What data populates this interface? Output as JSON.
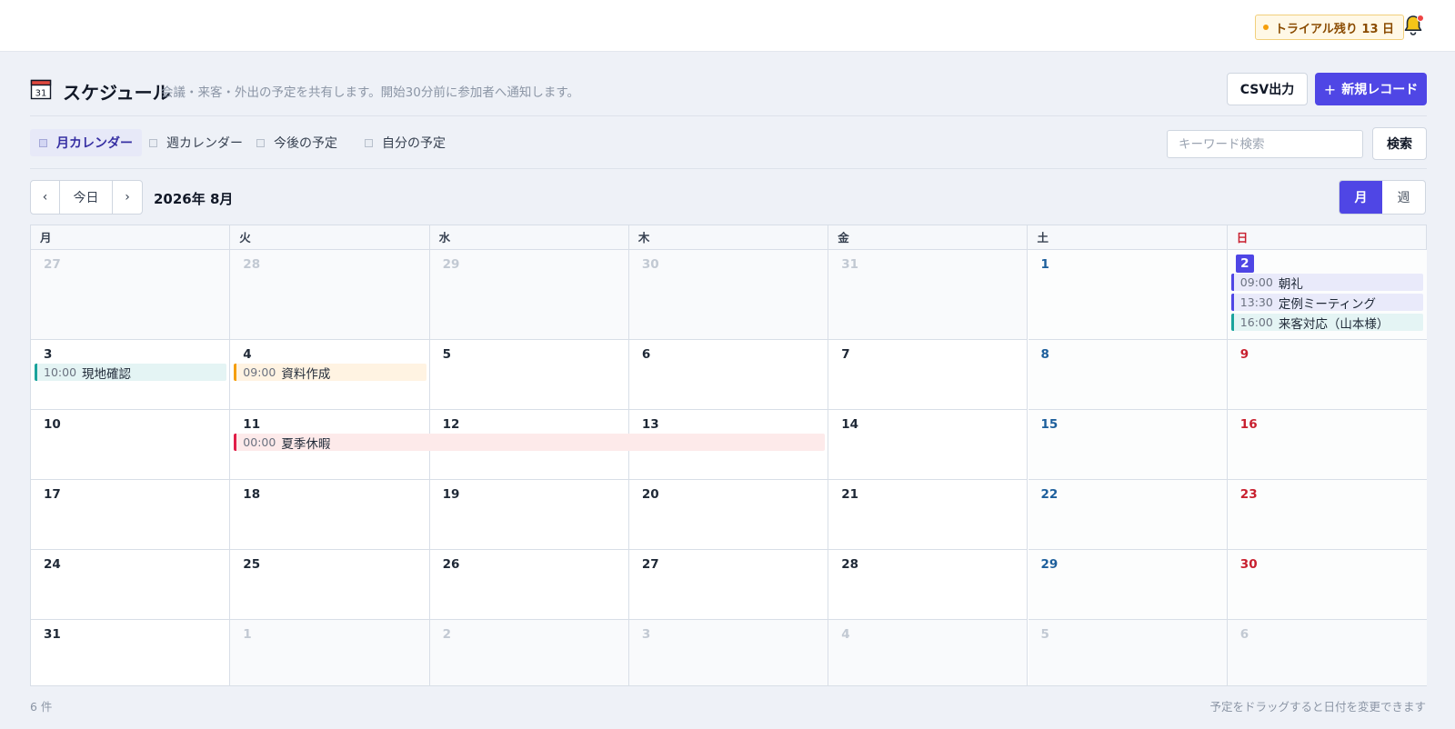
{
  "topbar": {
    "trial_label": "トライアル残り 13 日",
    "bell_icon": "bell-icon"
  },
  "header": {
    "icon": "calendar-icon",
    "title": "スケジュール",
    "subtitle": "会議・来客・外出の予定を共有します。開始30分前に参加者へ通知します。",
    "csv_label": "CSV出力",
    "new_label": "新規レコード",
    "new_icon": "plus-icon"
  },
  "tabs": [
    {
      "label": "月カレンダー",
      "active": true
    },
    {
      "label": "週カレンダー",
      "active": false
    },
    {
      "label": "今後の予定",
      "active": false
    },
    {
      "label": "自分の予定",
      "active": false
    }
  ],
  "search": {
    "placeholder": "キーワード検索",
    "value": "",
    "button_label": "検索"
  },
  "nav": {
    "prev_label": "‹",
    "today_label": "今日",
    "next_label": "›",
    "month_label": "2026年 8月",
    "view_month_label": "月",
    "view_week_label": "週"
  },
  "calendar": {
    "weekdays": [
      "月",
      "火",
      "水",
      "木",
      "金",
      "土",
      "日"
    ],
    "weeks": [
      [
        {
          "day": "27",
          "other": true
        },
        {
          "day": "28",
          "other": true
        },
        {
          "day": "29",
          "other": true
        },
        {
          "day": "30",
          "other": true
        },
        {
          "day": "31",
          "other": true
        },
        {
          "day": "1"
        },
        {
          "day": "2",
          "today": true
        }
      ],
      [
        {
          "day": "3"
        },
        {
          "day": "4"
        },
        {
          "day": "5"
        },
        {
          "day": "6"
        },
        {
          "day": "7"
        },
        {
          "day": "8"
        },
        {
          "day": "9"
        }
      ],
      [
        {
          "day": "10"
        },
        {
          "day": "11"
        },
        {
          "day": "12"
        },
        {
          "day": "13"
        },
        {
          "day": "14"
        },
        {
          "day": "15"
        },
        {
          "day": "16"
        }
      ],
      [
        {
          "day": "17"
        },
        {
          "day": "18"
        },
        {
          "day": "19"
        },
        {
          "day": "20"
        },
        {
          "day": "21"
        },
        {
          "day": "22"
        },
        {
          "day": "23"
        }
      ],
      [
        {
          "day": "24"
        },
        {
          "day": "25"
        },
        {
          "day": "26"
        },
        {
          "day": "27"
        },
        {
          "day": "28"
        },
        {
          "day": "29"
        },
        {
          "day": "30"
        }
      ],
      [
        {
          "day": "31"
        },
        {
          "day": "1",
          "other": true
        },
        {
          "day": "2",
          "other": true
        },
        {
          "day": "3",
          "other": true
        },
        {
          "day": "4",
          "other": true
        },
        {
          "day": "5",
          "other": true
        },
        {
          "day": "6",
          "other": true
        }
      ]
    ],
    "events": [
      {
        "week": 0,
        "day": 6,
        "slot": 0,
        "span": 1,
        "time": "09:00",
        "title": "朝礼",
        "color": "indigo"
      },
      {
        "week": 0,
        "day": 6,
        "slot": 1,
        "span": 1,
        "time": "13:30",
        "title": "定例ミーティング",
        "color": "indigo"
      },
      {
        "week": 0,
        "day": 6,
        "slot": 2,
        "span": 1,
        "time": "16:00",
        "title": "来客対応（山本様）",
        "color": "teal"
      },
      {
        "week": 1,
        "day": 0,
        "slot": 0,
        "span": 1,
        "time": "10:00",
        "title": "現地確認",
        "color": "teal"
      },
      {
        "week": 1,
        "day": 1,
        "slot": 0,
        "span": 1,
        "time": "09:00",
        "title": "資料作成",
        "color": "orange"
      },
      {
        "week": 2,
        "day": 1,
        "slot": 0,
        "span": 3,
        "time": "00:00",
        "title": "夏季休暇",
        "color": "red"
      }
    ],
    "colors": {
      "indigo": "#4f46e5",
      "teal": "#1aa39c",
      "orange": "#f59e0b",
      "red": "#e11d48"
    }
  },
  "footer": {
    "count_label": "6 件",
    "hint": "予定をドラッグすると日付を変更できます"
  }
}
